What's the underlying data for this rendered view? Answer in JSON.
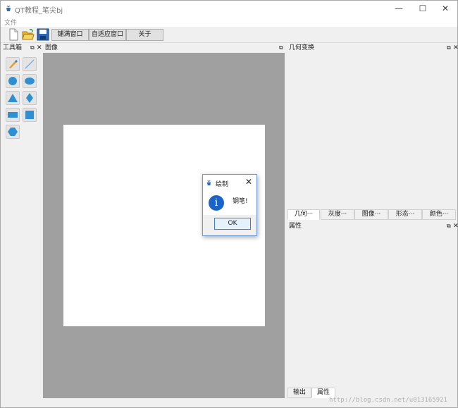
{
  "window": {
    "title": "QT教程_笔尖bj",
    "controls": {
      "minimize": "—",
      "maximize": "☐",
      "close": "✕"
    }
  },
  "menubar": {
    "items": [
      "文件"
    ]
  },
  "toolbar": {
    "icons": [
      "new-file-icon",
      "open-folder-icon",
      "save-icon"
    ],
    "buttons": [
      "铺满窗口",
      "自适应窗口",
      "关于"
    ]
  },
  "toolbox": {
    "title": "工具箱",
    "tools": [
      "pen-icon",
      "line-icon",
      "circle-icon",
      "ellipse-icon",
      "triangle-icon",
      "diamond-icon",
      "rectangle-icon",
      "square-icon",
      "hexagon-icon"
    ]
  },
  "image_dock": {
    "title": "图像"
  },
  "geometry_dock": {
    "title": "几何变换",
    "tabs": [
      "几何···",
      "灰度···",
      "图像···",
      "形态···",
      "颜色···"
    ],
    "active_tab": 0
  },
  "properties_dock": {
    "title": "属性",
    "tabs": [
      "输出",
      "属性"
    ],
    "active_tab": 1
  },
  "dialog": {
    "title": "绘制",
    "message": "钢笔!",
    "ok_label": "OK"
  },
  "watermark": "http://blog.csdn.net/u013165921",
  "colors": {
    "accent": "#1a64c8",
    "canvas_bg": "#a0a0a0",
    "tool_blue": "#2f8fd0"
  }
}
